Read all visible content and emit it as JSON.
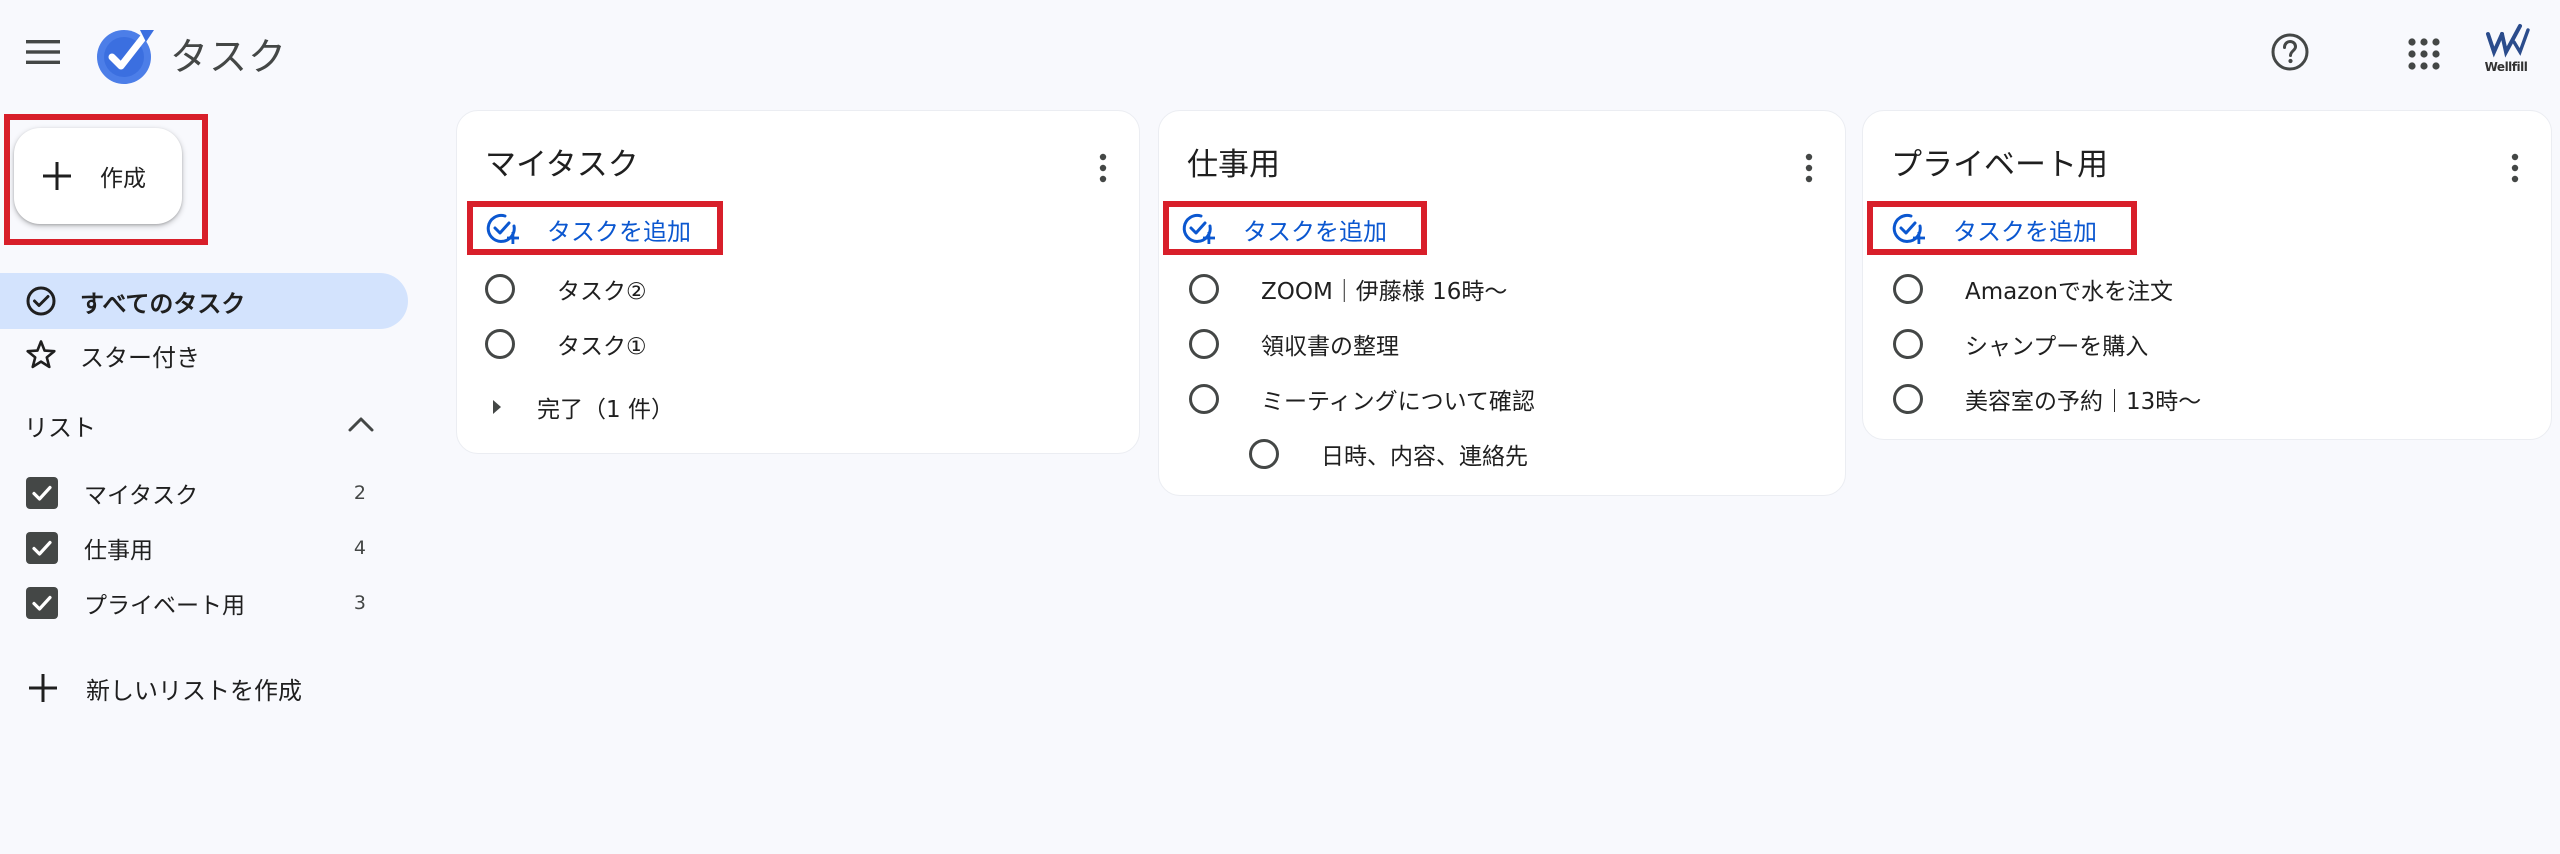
{
  "header": {
    "app_title": "タスク",
    "account_label": "Wellfill"
  },
  "sidebar": {
    "create_label": "作成",
    "nav": [
      {
        "label": "すべてのタスク",
        "icon": "task-check-icon",
        "selected": true
      },
      {
        "label": "スター付き",
        "icon": "star-icon",
        "selected": false
      }
    ],
    "lists_heading": "リスト",
    "lists": [
      {
        "name": "マイタスク",
        "count": "2",
        "checked": true
      },
      {
        "name": "仕事用",
        "count": "4",
        "checked": true
      },
      {
        "name": "プライベート用",
        "count": "3",
        "checked": true
      }
    ],
    "new_list_label": "新しいリストを作成"
  },
  "cards": [
    {
      "title": "マイタスク",
      "add_task_label": "タスクを追加",
      "tasks": [
        {
          "text": "タスク②"
        },
        {
          "text": "タスク①"
        }
      ],
      "completed_label": "完了（1 件）"
    },
    {
      "title": "仕事用",
      "add_task_label": "タスクを追加",
      "tasks": [
        {
          "text": "ZOOM｜伊藤様 16時〜"
        },
        {
          "text": "領収書の整理"
        },
        {
          "text": "ミーティングについて確認"
        },
        {
          "text": "日時、内容、連絡先",
          "subtask": true
        }
      ]
    },
    {
      "title": "プライベート用",
      "add_task_label": "タスクを追加",
      "tasks": [
        {
          "text": "Amazonで水を注文"
        },
        {
          "text": "シャンプーを購入"
        },
        {
          "text": "美容室の予約｜13時〜"
        }
      ]
    }
  ],
  "colors": {
    "accent": "#0b57d0",
    "selected_bg": "#d3e3fd",
    "highlight": "#d81f2a",
    "background": "#f8f9fd"
  }
}
